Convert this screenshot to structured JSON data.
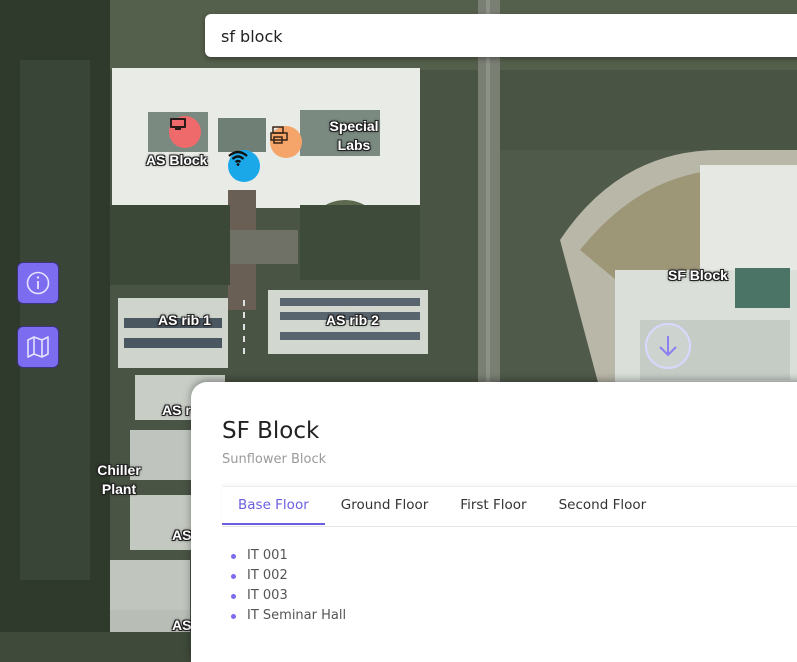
{
  "search": {
    "value": "sf block"
  },
  "map": {
    "labels": [
      {
        "key": "as-block",
        "text": "AS Block"
      },
      {
        "key": "special-labs",
        "text": "Special\nLabs"
      },
      {
        "key": "sf-block",
        "text": "SF Block"
      },
      {
        "key": "as-rib-1",
        "text": "AS rib 1"
      },
      {
        "key": "as-rib-2",
        "text": "AS rib 2"
      },
      {
        "key": "as-r",
        "text": "AS r"
      },
      {
        "key": "chiller-plant",
        "text": "Chiller\nPlant"
      },
      {
        "key": "as-3",
        "text": "AS"
      },
      {
        "key": "as-4",
        "text": "AS"
      }
    ],
    "markers": [
      {
        "key": "computer-lab",
        "icon": "computer-icon",
        "color": "#ef6b6b"
      },
      {
        "key": "wifi",
        "icon": "wifi-icon",
        "color": "#1aa8e8"
      },
      {
        "key": "printer",
        "icon": "printer-icon",
        "color": "#f5a46a"
      }
    ]
  },
  "controls": {
    "info_icon": "info-icon",
    "map_icon": "map-icon",
    "down_icon": "arrow-down-icon",
    "accent": "#7c6cf0"
  },
  "panel": {
    "title": "SF Block",
    "subtitle": "Sunflower Block",
    "tabs": [
      "Base Floor",
      "Ground Floor",
      "First Floor",
      "Second Floor"
    ],
    "active_tab": "Base Floor",
    "rooms": [
      "IT 001",
      "IT 002",
      "IT 003",
      "IT Seminar Hall"
    ]
  }
}
